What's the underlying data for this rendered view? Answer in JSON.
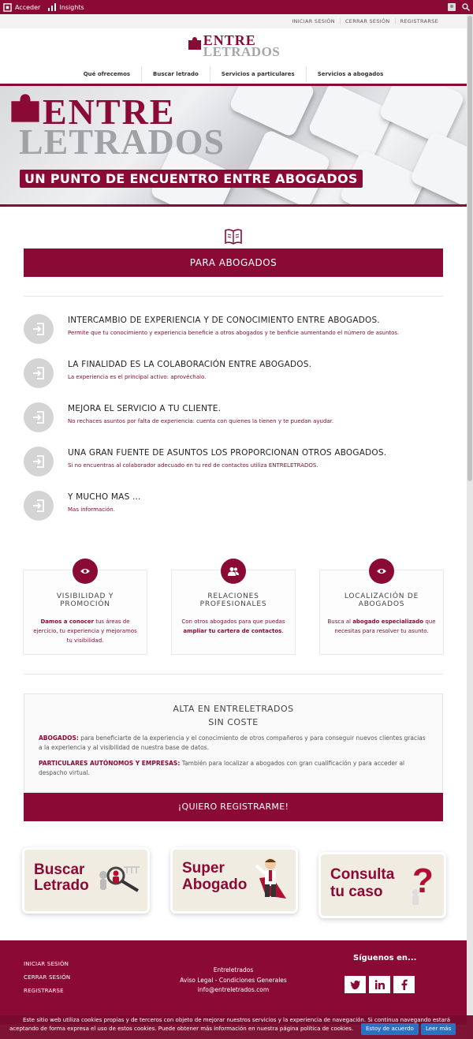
{
  "adminbar": {
    "acceder": "Acceder",
    "insights": "Insights"
  },
  "topbar": {
    "login": "INICIAR SESIÓN",
    "logout": "CERRAR SESIÓN",
    "register": "REGISTRARSE"
  },
  "logo": {
    "line1": "ENTRE",
    "line2": "LETRADOS"
  },
  "nav": [
    "Qué ofrecemos",
    "Buscar letrado",
    "Servicios a particulares",
    "Servicios a abogados"
  ],
  "hero": {
    "line1": "ENTRE",
    "line2": "LETRADOS",
    "tagline": "UN PUNTO DE ENCUENTRO ENTRE ABOGADOS"
  },
  "section_button": "PARA ABOGADOS",
  "features": [
    {
      "title": "INTERCAMBIO DE EXPERIENCIA Y DE CONOCIMIENTO ENTRE ABOGADOS.",
      "desc": "Permite que tu conocimiento y experiencia beneficie a otros abogados y te benficie aumentando el número de asuntos."
    },
    {
      "title": "LA FINALIDAD ES LA COLABORACIÓN ENTRE ABOGADOS.",
      "desc": "La experiencia es el principal activo: aprovéchalo."
    },
    {
      "title": "MEJORA EL SERVICIO A TU CLIENTE.",
      "desc": "No rechaces asuntos por falta de experiencia: cuenta con quienes la tienen y te puedan ayudar."
    },
    {
      "title": "UNA GRAN FUENTE DE ASUNTOS LOS PROPORCIONAN OTROS ABOGADOS.",
      "desc": "Si no encuentras al colaborador adecuado en tu red de contactos utiliza ENTRELETRADOS."
    },
    {
      "title": "Y MUCHO MAS ...",
      "desc": "Mas información."
    }
  ],
  "cards": [
    {
      "title1": "VISIBILIDAD Y",
      "title2": "PROMOCIÓN",
      "bold1": "Damos a conocer",
      "rest1": " tus áreas de ejercicio, tu experiencia y mejoramos tu visibilidad.",
      "icon": "eye-icon"
    },
    {
      "title1": "RELACIONES",
      "title2": "PROFESIONALES",
      "pre": "Con otros abogados para que puedas ",
      "bold1": "ampliar tu cartera de contactos",
      "rest1": ".",
      "icon": "users-icon"
    },
    {
      "title1": "LOCALIZACIÓN DE",
      "title2": "ABOGADOS",
      "pre": "Busca al ",
      "bold1": "abogado especializado",
      "rest1": " que necesitas para resolver tu asunto.",
      "icon": "eye-icon"
    }
  ],
  "alta": {
    "title1": "ALTA EN ENTRELETRADOS",
    "title2": "SIN COSTE",
    "p1_label": "ABOGADOS:",
    "p1_text": " para beneficiarte de la experiencia y el conocimiento de otros compañeros  y para conseguir nuevos clientes gracias a la experiencia y al visibilidad de nuestra base de datos.",
    "p2_label": "PARTICULARES AUTÓNOMOS Y EMPRESAS:",
    "p2_text": " También para localizar a abogados con gran cualificación y para acceder al despacho virtual."
  },
  "register_button": "¡QUIERO REGISTRARME!",
  "banners": [
    {
      "l1": "Buscar",
      "l2": "Letrado"
    },
    {
      "l1": "Super",
      "l2": "Abogado"
    },
    {
      "l1": "Consulta",
      "l2": "tu caso"
    }
  ],
  "footer": {
    "links": [
      "INICIAR SESIÓN",
      "CERRAR SESIÓN",
      "REGISTRARSE"
    ],
    "company": "Entreletrados",
    "legal": "Aviso Legal - Condiciones Generales",
    "email": "info@entreletrados.com",
    "follow": "Síguenos en..."
  },
  "cookie": {
    "line1": "Este sitio web utiliza cookies propias y de terceros con objeto de mejorar nuestros servicios y la experiencia de navegación. Si continua navegando estará",
    "line2": "aceptando de forma expresa el uso de estos cookies. Puede obtener más información en nuestra página política de cookies.",
    "accept": "Estoy de acuerdo",
    "more": "Leer más"
  },
  "colors": {
    "brand": "#8a0a35",
    "grey_icon": "#d4d4d4",
    "cookie_button": "#2a71c4"
  }
}
